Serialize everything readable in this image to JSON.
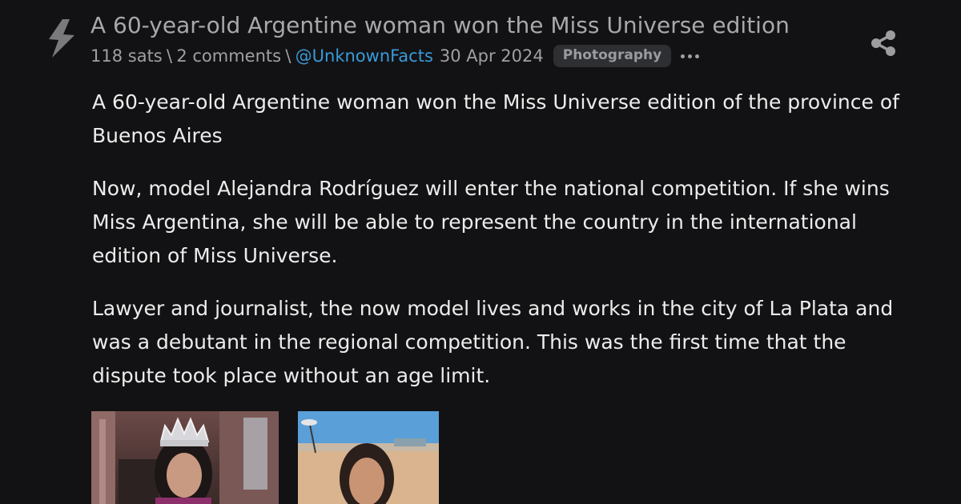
{
  "post": {
    "title": "A 60-year-old Argentine woman won the Miss Universe edition",
    "sats": "118 sats",
    "sep1": "\\",
    "comments": "2 comments",
    "sep2": "\\",
    "author": "@UnknownFacts",
    "date": "30 Apr 2024",
    "tag": "Photography"
  },
  "body": {
    "paragraphs": [
      "A 60-year-old Argentine woman won the Miss Universe edition of the province of Buenos Aires",
      "Now, model Alejandra Rodríguez will enter the national competition.  If she wins Miss Argentina, she will be able to represent the country in the international edition of Miss Universe.",
      "Lawyer and journalist, the now model lives and works in the city of La Plata and was a debutant in the regional competition.  This was the first time that the dispute took place without an age limit."
    ]
  },
  "icons": {
    "zap": "zap-icon",
    "more": "more-icon",
    "share": "share-icon"
  },
  "colors": {
    "background": "#121214",
    "title": "#a8a8ab",
    "meta": "#a0a0a3",
    "link": "#3a9ad9",
    "tag_bg": "#2e2f33",
    "body_text": "#ececec"
  }
}
